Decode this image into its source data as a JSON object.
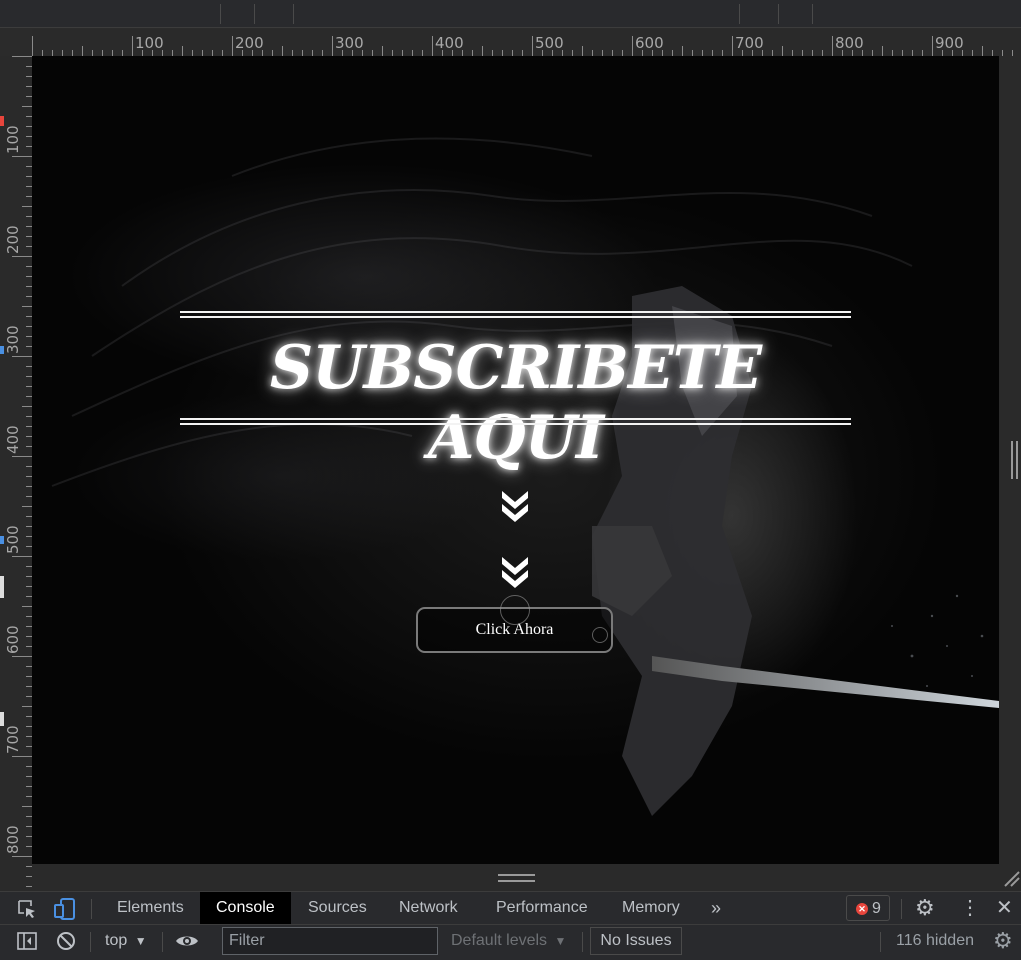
{
  "ruler": {
    "h_labels": [
      "100",
      "200",
      "300",
      "400",
      "500",
      "600",
      "700",
      "800",
      "900"
    ],
    "v_labels": [
      "100",
      "200",
      "300",
      "400",
      "500",
      "600",
      "700",
      "800"
    ]
  },
  "page": {
    "headline": "SUBSCRIBETE AQUI",
    "cta_label": "Click Ahora"
  },
  "devtools": {
    "tabs": [
      "Elements",
      "Console",
      "Sources",
      "Network",
      "Performance",
      "Memory"
    ],
    "active_tab": "Console",
    "more_tabs_icon": "double-chevron-right-icon",
    "error_count": "9",
    "context": "top",
    "filter_placeholder": "Filter",
    "levels_label": "Default levels",
    "issues_label": "No Issues",
    "hidden_label": "116 hidden"
  },
  "colors": {
    "error": "#e8453c",
    "device_toggle": "#4a90e2",
    "headline": "#ffffff"
  }
}
